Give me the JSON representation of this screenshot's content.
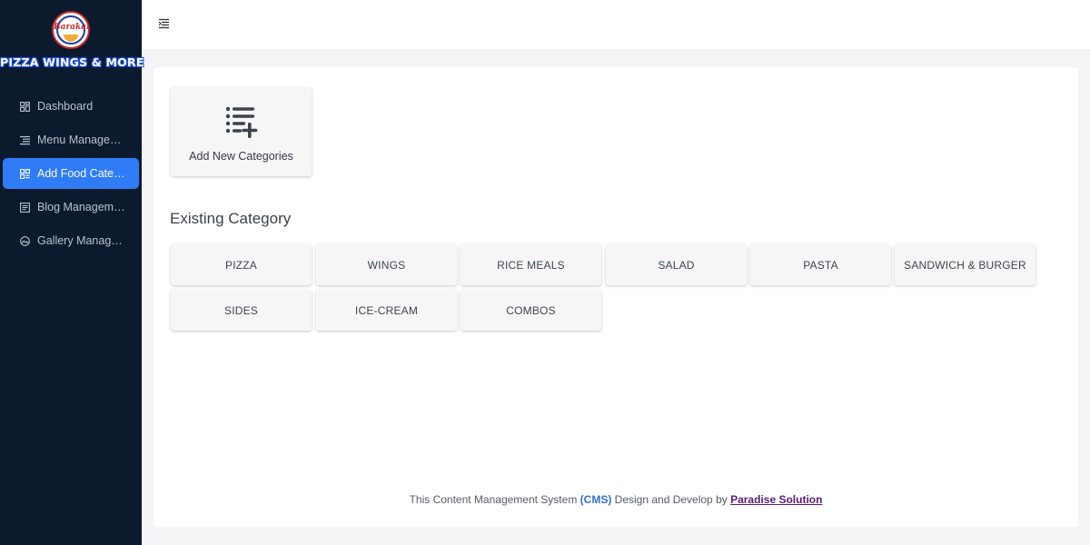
{
  "brand": {
    "logo_text": "Barakah",
    "name": "PIZZA WINGS & MORE"
  },
  "sidebar": {
    "items": [
      {
        "label": "Dashboard",
        "icon": "dashboard-icon",
        "active": false
      },
      {
        "label": "Menu Management",
        "icon": "menu-list-icon",
        "active": false
      },
      {
        "label": "Add Food Category",
        "icon": "category-icon",
        "active": true
      },
      {
        "label": "Blog Management",
        "icon": "blog-icon",
        "active": false
      },
      {
        "label": "Gallery Management",
        "icon": "gallery-icon",
        "active": false
      }
    ]
  },
  "topbar": {
    "menu_icon": "hamburger-menu-icon"
  },
  "main": {
    "add_card": {
      "label": "Add New Categories",
      "icon": "add-list-icon"
    },
    "section_title": "Existing Category",
    "categories": [
      "PIZZA",
      "WINGS",
      "RICE MEALS",
      "SALAD",
      "PASTA",
      "SANDWICH & BURGER",
      "SIDES",
      "ICE-CREAM",
      "COMBOS"
    ]
  },
  "footer": {
    "prefix": "This Content Management System ",
    "cms": "(CMS)",
    "middle": " Design and Develop by ",
    "link": "Paradise Solution"
  },
  "colors": {
    "sidebar_bg": "#0c1a2e",
    "active_item": "#2f7cf6",
    "cms_blue": "#2f6fd6",
    "link_purple": "#5b1a7a"
  }
}
